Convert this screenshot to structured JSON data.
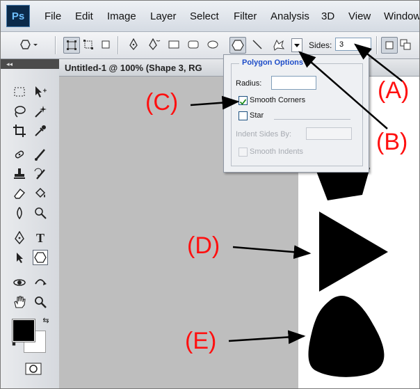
{
  "app": {
    "logo": "Ps"
  },
  "menu": [
    "File",
    "Edit",
    "Image",
    "Layer",
    "Select",
    "Filter",
    "Analysis",
    "3D",
    "View",
    "Window"
  ],
  "options_bar": {
    "sides_label": "Sides:",
    "sides_value": "3"
  },
  "panel": {
    "collapse_glyph": "◂◂"
  },
  "document": {
    "title": "Untitled-1 @ 100% (Shape 3, RG"
  },
  "polygon_options": {
    "title": "Polygon Options",
    "radius_label": "Radius:",
    "radius_value": "",
    "smooth_corners_label": "Smooth Corners",
    "smooth_corners_checked": true,
    "star_label": "Star",
    "star_checked": false,
    "indent_label": "Indent Sides By:",
    "indent_value": "",
    "smooth_indents_label": "Smooth Indents",
    "smooth_indents_checked": false
  },
  "annotations": {
    "a": "(A)",
    "b": "(B)",
    "c": "(C)",
    "d": "(D)",
    "e": "(E)",
    "color": "#ff1010"
  },
  "colors": {
    "foreground": "#000000",
    "background": "#ffffff",
    "accent": "#1d4cc8"
  }
}
